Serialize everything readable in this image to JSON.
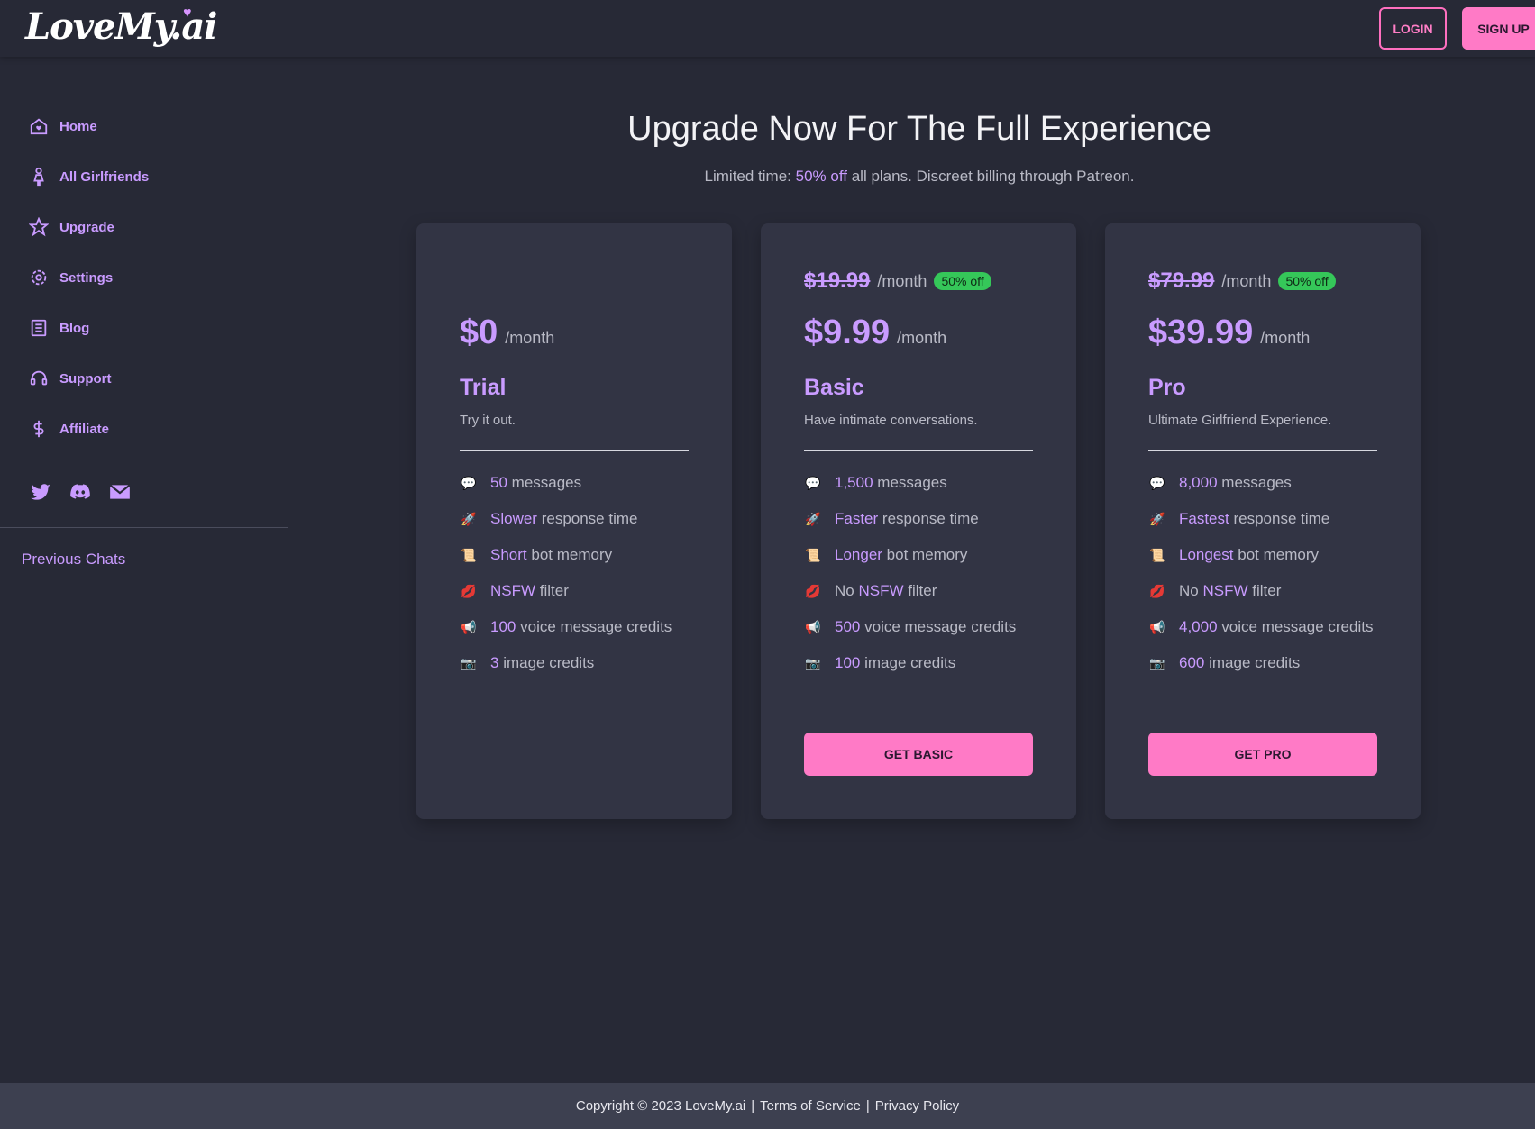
{
  "header": {
    "logo_text": "LoveMy.ai",
    "login_label": "LOGIN",
    "signup_label": "SIGN UP"
  },
  "sidebar": {
    "items": [
      {
        "label": "Home",
        "icon": "home-icon"
      },
      {
        "label": "All Girlfriends",
        "icon": "girl-icon"
      },
      {
        "label": "Upgrade",
        "icon": "star-icon"
      },
      {
        "label": "Settings",
        "icon": "gear-icon"
      },
      {
        "label": "Blog",
        "icon": "document-icon"
      },
      {
        "label": "Support",
        "icon": "headset-icon"
      },
      {
        "label": "Affiliate",
        "icon": "dollar-icon"
      }
    ],
    "social": [
      "twitter-icon",
      "discord-icon",
      "mail-icon"
    ],
    "previous_chats": "Previous Chats"
  },
  "main": {
    "heading": "Upgrade Now For The Full Experience",
    "sub_prefix": "Limited time:",
    "sub_highlight": "50% off",
    "sub_suffix": "all plans. Discreet billing through Patreon.",
    "plans": [
      {
        "price": "$0",
        "per": "/month",
        "name": "Trial",
        "desc": "Try it out.",
        "features": [
          {
            "icon": "💬",
            "val": "50",
            "rest": "messages"
          },
          {
            "icon": "🚀",
            "val": "Slower",
            "rest": "response time"
          },
          {
            "icon": "📜",
            "val": "Short",
            "rest": "bot memory"
          },
          {
            "icon": "💋",
            "pre": "",
            "val": "NSFW",
            "rest": "filter"
          },
          {
            "icon": "📢",
            "val": "100",
            "rest": "voice message credits"
          },
          {
            "icon": "📷",
            "val": "3",
            "rest": "image credits"
          }
        ]
      },
      {
        "old_price": "$19.99",
        "old_per": "/month",
        "off": "50% off",
        "price": "$9.99",
        "per": "/month",
        "name": "Basic",
        "desc": "Have intimate conversations.",
        "features": [
          {
            "icon": "💬",
            "val": "1,500",
            "rest": "messages"
          },
          {
            "icon": "🚀",
            "val": "Faster",
            "rest": "response time"
          },
          {
            "icon": "📜",
            "val": "Longer",
            "rest": "bot memory"
          },
          {
            "icon": "💋",
            "pre": "No",
            "val": "NSFW",
            "rest": "filter"
          },
          {
            "icon": "📢",
            "val": "500",
            "rest": "voice message credits"
          },
          {
            "icon": "📷",
            "val": "100",
            "rest": "image credits"
          }
        ],
        "cta": "GET BASIC"
      },
      {
        "old_price": "$79.99",
        "old_per": "/month",
        "off": "50% off",
        "price": "$39.99",
        "per": "/month",
        "name": "Pro",
        "desc": "Ultimate Girlfriend Experience.",
        "features": [
          {
            "icon": "💬",
            "val": "8,000",
            "rest": "messages"
          },
          {
            "icon": "🚀",
            "val": "Fastest",
            "rest": "response time"
          },
          {
            "icon": "📜",
            "val": "Longest",
            "rest": "bot memory"
          },
          {
            "icon": "💋",
            "pre": "No",
            "val": "NSFW",
            "rest": "filter"
          },
          {
            "icon": "📢",
            "val": "4,000",
            "rest": "voice message credits"
          },
          {
            "icon": "📷",
            "val": "600",
            "rest": "image credits"
          }
        ],
        "cta": "GET PRO"
      }
    ]
  },
  "footer": {
    "copyright": "Copyright © 2023 LoveMy.ai",
    "sep1": "|",
    "terms": "Terms of Service",
    "sep2": "|",
    "privacy": "Privacy Policy"
  },
  "colors": {
    "background": "#272936",
    "card": "#323444",
    "accent_purple": "#c99bff",
    "accent_pink": "#ff7ac6",
    "badge_green": "#35c759"
  }
}
